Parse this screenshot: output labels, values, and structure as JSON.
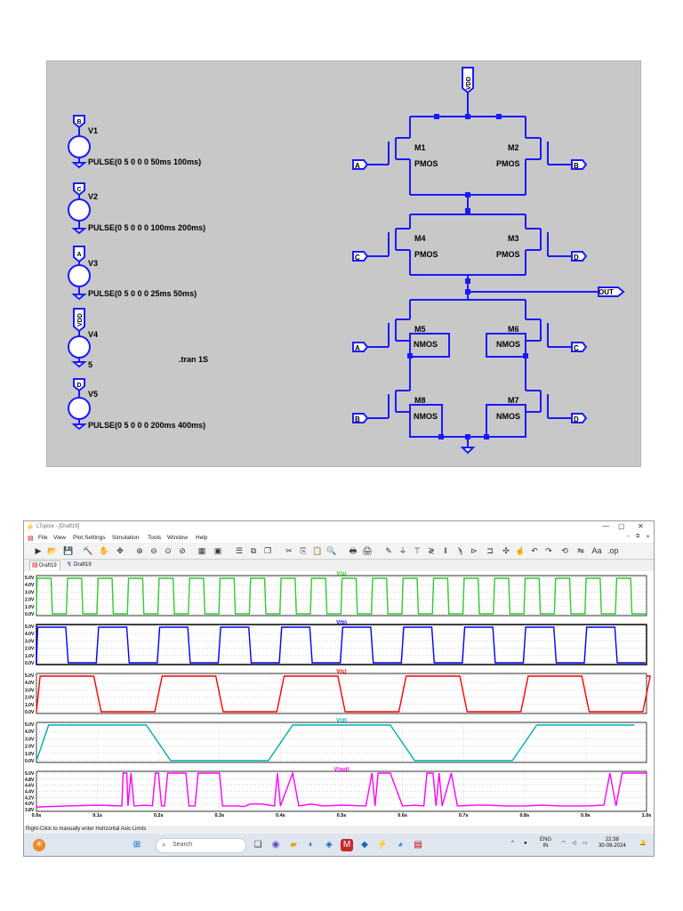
{
  "schematic": {
    "sources": [
      {
        "net": "B",
        "name": "V1",
        "value": "PULSE(0 5 0 0 0 50ms 100ms)"
      },
      {
        "net": "C",
        "name": "V2",
        "value": "PULSE(0 5 0 0 0 100ms 200ms)"
      },
      {
        "net": "A",
        "name": "V3",
        "value": "PULSE(0 5 0 0 0 25ms 50ms)"
      },
      {
        "net": "VDD",
        "name": "V4",
        "value": "5"
      },
      {
        "net": "D",
        "name": "V5",
        "value": "PULSE(0 5 0 0 0 200ms 400ms)"
      }
    ],
    "directive": ".tran 1S",
    "vdd_label": "VDD",
    "out_label": "OUT",
    "transistors": [
      {
        "name": "M1",
        "model": "PMOS"
      },
      {
        "name": "M2",
        "model": "PMOS"
      },
      {
        "name": "M4",
        "model": "PMOS"
      },
      {
        "name": "M3",
        "model": "PMOS"
      },
      {
        "name": "M5",
        "model": "NMOS"
      },
      {
        "name": "M6",
        "model": "NMOS"
      },
      {
        "name": "M8",
        "model": "NMOS"
      },
      {
        "name": "M7",
        "model": "NMOS"
      }
    ],
    "input_flags": [
      "A",
      "B",
      "C",
      "D",
      "A",
      "C",
      "B",
      "D"
    ]
  },
  "window": {
    "title": "LTspice - [Draft19]",
    "menu": [
      "File",
      "View",
      "Plot Settings",
      "Simulation",
      "Tools",
      "Window",
      "Help"
    ],
    "tabs": [
      "Draft19",
      "Draft19"
    ],
    "status": "Right-Click to manually enter Horizontal Axis Limits"
  },
  "plots": {
    "x_ticks": [
      "0.0s",
      "0.1s",
      "0.2s",
      "0.3s",
      "0.4s",
      "0.5s",
      "0.6s",
      "0.7s",
      "0.8s",
      "0.9s",
      "1.0s"
    ],
    "panes": [
      {
        "title": "V(a)",
        "color": "#2ecc2e",
        "y_ticks": [
          "5.0V",
          "4.0V",
          "3.0V",
          "2.0V",
          "1.0V",
          "0.0V"
        ],
        "period": 0.05,
        "edge": 0.001
      },
      {
        "title": "V(b)",
        "color": "#0000ff",
        "y_ticks": [
          "5.0V",
          "4.0V",
          "3.0V",
          "2.0V",
          "1.0V",
          "0.0V"
        ],
        "period": 0.1,
        "edge": 0.002
      },
      {
        "title": "V(c)",
        "color": "#ff0000",
        "y_ticks": [
          "5.0V",
          "4.0V",
          "3.0V",
          "2.0V",
          "1.0V",
          "0.0V"
        ],
        "period": 0.2,
        "edge": 0.006
      },
      {
        "title": "V(d)",
        "color": "#00b0b0",
        "y_ticks": [
          "5.0V",
          "4.0V",
          "3.0V",
          "2.0V",
          "1.0V",
          "0.0V"
        ],
        "period": 0.4,
        "edge": 0.02
      },
      {
        "title": "V(out)",
        "color": "#ff00ff",
        "y_ticks": [
          "5.0V",
          "4.8V",
          "4.6V",
          "4.4V",
          "4.2V",
          "4.0V",
          "3.8V"
        ],
        "period": 0,
        "edge": 0
      }
    ]
  },
  "taskbar": {
    "search_placeholder": "Search",
    "lang_top": "ENG",
    "lang_bottom": "IN",
    "time": "22:38",
    "date": "30-09-2024"
  }
}
